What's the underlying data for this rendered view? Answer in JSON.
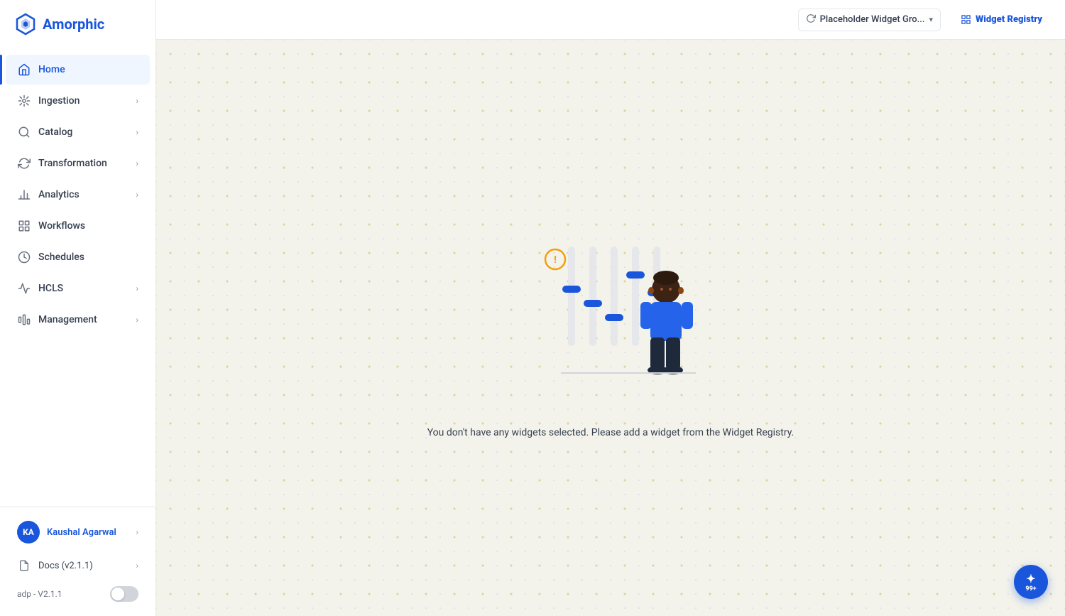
{
  "sidebar": {
    "logo": {
      "text": "Amorphic",
      "icon": "⬡"
    },
    "nav_items": [
      {
        "id": "home",
        "label": "Home",
        "active": true,
        "has_chevron": false
      },
      {
        "id": "ingestion",
        "label": "Ingestion",
        "active": false,
        "has_chevron": true
      },
      {
        "id": "catalog",
        "label": "Catalog",
        "active": false,
        "has_chevron": true
      },
      {
        "id": "transformation",
        "label": "Transformation",
        "active": false,
        "has_chevron": true
      },
      {
        "id": "analytics",
        "label": "Analytics",
        "active": false,
        "has_chevron": true
      },
      {
        "id": "workflows",
        "label": "Workflows",
        "active": false,
        "has_chevron": false
      },
      {
        "id": "schedules",
        "label": "Schedules",
        "active": false,
        "has_chevron": false
      },
      {
        "id": "hcls",
        "label": "HCLS",
        "active": false,
        "has_chevron": true
      },
      {
        "id": "management",
        "label": "Management",
        "active": false,
        "has_chevron": true
      }
    ],
    "user": {
      "initials": "KA",
      "name": "Kaushal Agarwal"
    },
    "docs_label": "Docs (v2.1.1)",
    "version_label": "adp - V2.1.1",
    "toggle_on": false
  },
  "header": {
    "widget_group_name": "Placeholder Widget Gro...",
    "widget_registry_label": "Widget Registry",
    "refresh_tooltip": "refresh"
  },
  "content": {
    "empty_message": "You don't have any widgets selected. Please add a widget from the Widget Registry.",
    "illustration_alt": "No widgets selected illustration"
  },
  "fab": {
    "badge": "99+",
    "icon": "✦"
  }
}
